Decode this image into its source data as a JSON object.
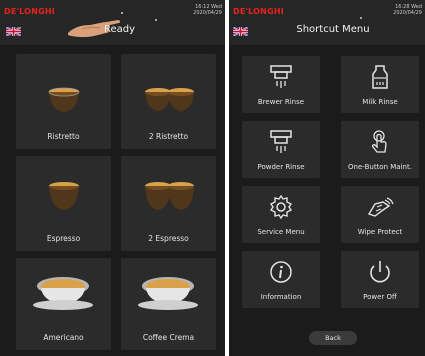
{
  "left_screen": {
    "brand": "DE'LONGHI",
    "clock_time": "16:12 Wed",
    "clock_date": "2020/04/29",
    "status": "Ready",
    "drinks": [
      {
        "label": "Ristretto",
        "icon": "single-espresso-cup-icon"
      },
      {
        "label": "2 Ristretto",
        "icon": "double-espresso-cup-icon"
      },
      {
        "label": "Espresso",
        "icon": "single-espresso-cup-icon"
      },
      {
        "label": "2 Espresso",
        "icon": "double-espresso-cup-icon"
      },
      {
        "label": "Americano",
        "icon": "large-cup-icon"
      },
      {
        "label": "Coffee Crema",
        "icon": "large-cup-icon"
      }
    ]
  },
  "right_screen": {
    "brand": "DE'LONGHI",
    "clock_time": "16:28 Wed",
    "clock_date": "2020/04/29",
    "title": "Shortcut Menu",
    "items": [
      {
        "label": "Brewer Rinse",
        "icon": "brewer-rinse-icon"
      },
      {
        "label": "Milk Rinse",
        "icon": "milk-rinse-icon"
      },
      {
        "label": "Powder Rinse",
        "icon": "powder-rinse-icon"
      },
      {
        "label": "One-Button Maint.",
        "icon": "touch-icon"
      },
      {
        "label": "Service Menu",
        "icon": "gear-icon"
      },
      {
        "label": "Wipe Protect",
        "icon": "wipe-icon"
      },
      {
        "label": "Information",
        "icon": "info-icon"
      },
      {
        "label": "Power Off",
        "icon": "power-icon"
      }
    ],
    "back_label": "Back"
  },
  "colors": {
    "brand": "#e8231b",
    "tile": "#2b2b2b",
    "background": "#1b1b1b",
    "crema": "#d9a24a"
  }
}
